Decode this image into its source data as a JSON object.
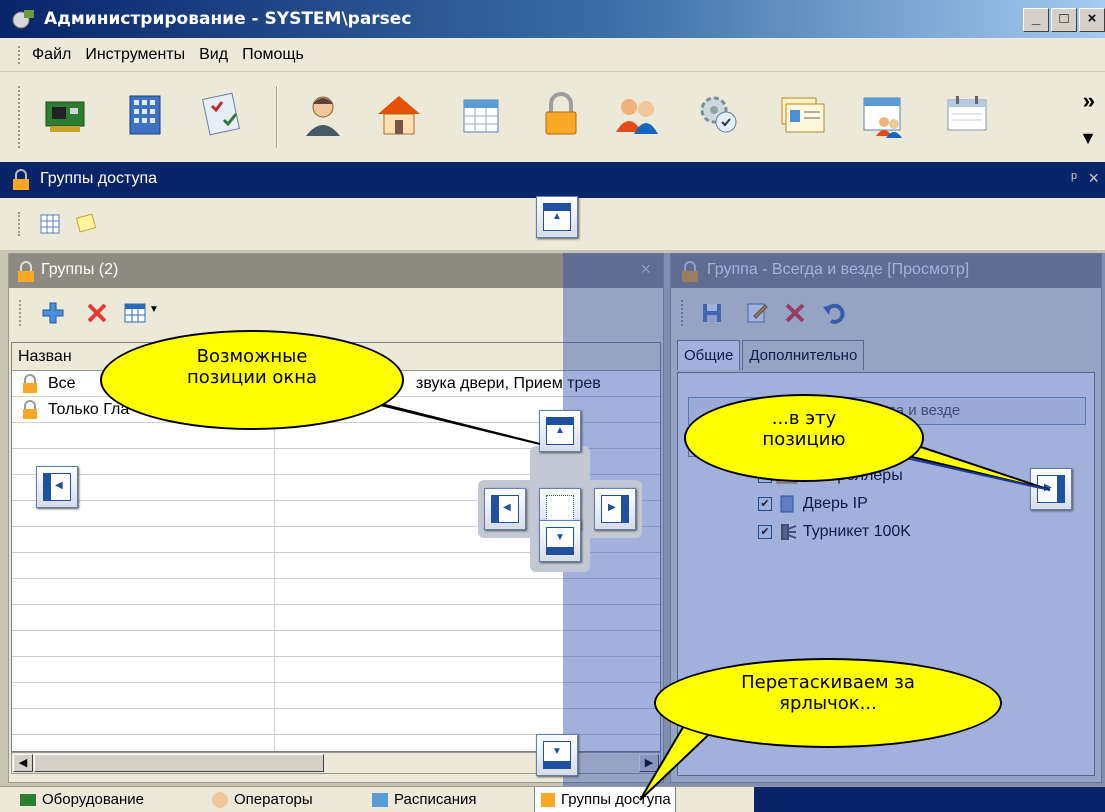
{
  "window": {
    "title": "Администрирование - SYSTEM\\parsec",
    "buttons": [
      "_",
      "□",
      "×"
    ]
  },
  "menu": [
    "Файл",
    "Инструменты",
    "Вид",
    "Помощь"
  ],
  "toolbar": {
    "icons": [
      "hardware-icon",
      "building-icon",
      "checklist-icon",
      "operator-icon",
      "home-icon",
      "schedule-icon",
      "lock-icon",
      "users-icon",
      "settings-icon",
      "id-card-icon",
      "calendar-users-icon",
      "calendar-icon"
    ],
    "overflow": "»"
  },
  "doc_window": {
    "title": "Группы доступа",
    "pin": "ᵖ",
    "close": "×"
  },
  "groups_panel": {
    "title": "Группы (2)",
    "column_header": "Назван",
    "rows": [
      {
        "name": "Все",
        "desc": "звука двери, Прием трев"
      },
      {
        "name": "Только Гла",
        "desc": ""
      }
    ]
  },
  "group_panel": {
    "title": "Группа - Всегда и везде [Просмотр]",
    "tabs": [
      "Общие",
      "Дополнительно"
    ],
    "name_value": "Всегда и везде",
    "name_visible": "да и везде",
    "tree": [
      {
        "label": "Контроллеры",
        "checked": false
      },
      {
        "label": "Дверь IP",
        "checked": true
      },
      {
        "label": "Турникет 100K",
        "checked": true
      }
    ]
  },
  "bottom_tabs": [
    "Оборудование",
    "Операторы",
    "Расписания",
    "Группы доступа"
  ],
  "callouts": {
    "positions": [
      "Возможные",
      "позиции окна"
    ],
    "target": [
      "...в эту",
      "позицию"
    ],
    "drag": [
      "Перетаскиваем за",
      "ярлычок..."
    ]
  }
}
